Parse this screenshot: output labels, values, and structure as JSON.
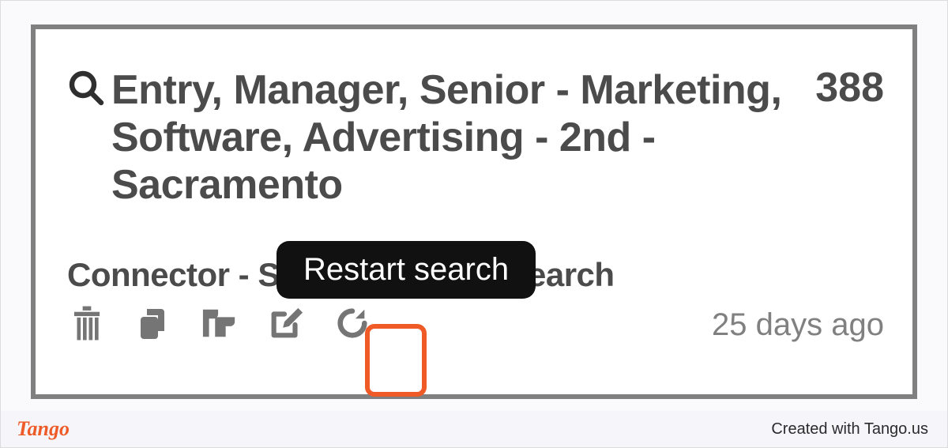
{
  "card": {
    "title": "Entry, Manager, Senior - Marketing, Software, Advertising - 2nd - Sacramento",
    "count": "388",
    "subtitle": "Connector - Sales Navigator search",
    "timestamp": "25 days ago"
  },
  "tooltip": {
    "label": "Restart search"
  },
  "footer": {
    "brand": "Tango",
    "credit": "Created with Tango.us"
  }
}
